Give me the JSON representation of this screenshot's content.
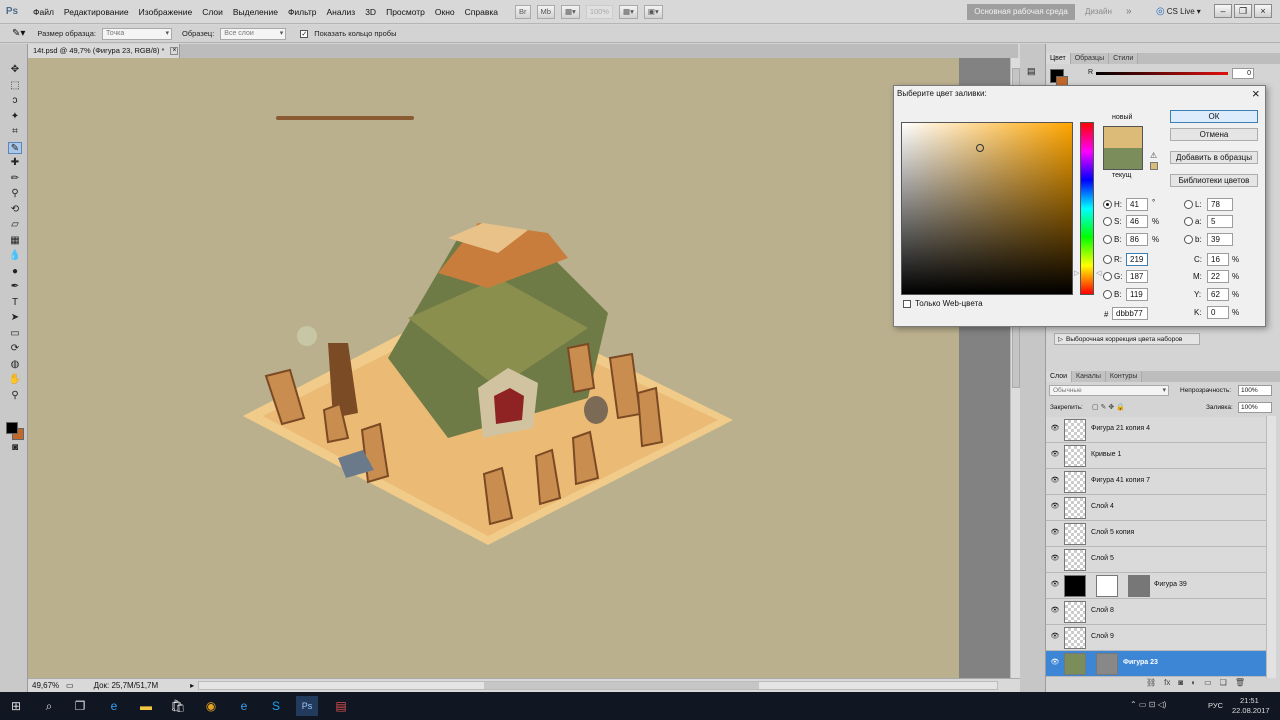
{
  "app": {
    "logo": "Ps"
  },
  "menu": [
    "Файл",
    "Редактирование",
    "Изображение",
    "Слои",
    "Выделение",
    "Фильтр",
    "Анализ",
    "3D",
    "Просмотр",
    "Окно",
    "Справка"
  ],
  "toolbar": {
    "zoom": "100%",
    "workspace": "Основная рабочая среда",
    "design": "Дизайн",
    "more": "»",
    "cslive": "CS Live"
  },
  "options_bar": {
    "sample_size_label": "Размер образца:",
    "sample_size_value": "Точка",
    "sample_label": "Образец:",
    "sample_value": "Все слои",
    "ring_label": "Показать кольцо пробы"
  },
  "document": {
    "tab_title": "14t.psd @ 49,7% (Фигура 23, RGB/8) *",
    "zoom_status": "49,67%",
    "doc_size": "Док: 25,7M/51,7M"
  },
  "color_panel": {
    "tabs": [
      "Цвет",
      "Образцы",
      "Стили"
    ],
    "r_label": "R",
    "r_value": "0"
  },
  "adjustments": {
    "item": "Выборочная коррекция цвета наборов"
  },
  "layers_panel": {
    "tabs": [
      "Слои",
      "Каналы",
      "Контуры"
    ],
    "blend_mode": "Обычные",
    "opacity_label": "Непрозрачность:",
    "opacity_value": "100%",
    "lock_label": "Закрепить:",
    "fill_label": "Заливка:",
    "fill_value": "100%",
    "layers": [
      {
        "name": "Фигура 21 копия 4"
      },
      {
        "name": "Кривые 1"
      },
      {
        "name": "Фигура 41 копия 7"
      },
      {
        "name": "Слой 4"
      },
      {
        "name": "Слой 5 копия"
      },
      {
        "name": "Слой 5"
      },
      {
        "name": "Фигура 39"
      },
      {
        "name": "Слой 8"
      },
      {
        "name": "Слой 9"
      },
      {
        "name": "Фигура 23"
      }
    ]
  },
  "dialog": {
    "title": "Выберите цвет заливки:",
    "close": "×",
    "ok": "ОК",
    "cancel": "Отмена",
    "add_swatches": "Добавить в образцы",
    "libraries": "Библиотеки цветов",
    "new_label": "новый",
    "current_label": "текущ",
    "new_color": "#dbbb77",
    "current_color": "#7b8d5a",
    "web_only": "Только Web-цвета",
    "h_label": "H:",
    "h_value": "41",
    "h_unit": "°",
    "s_label": "S:",
    "s_value": "46",
    "s_unit": "%",
    "b_label": "B:",
    "b_value": "86",
    "b_unit": "%",
    "r_label": "R:",
    "r_value": "219",
    "g_label": "G:",
    "g_value": "187",
    "b2_label": "B:",
    "b2_value": "119",
    "hex_label": "#",
    "hex_value": "dbbb77",
    "l_label": "L:",
    "l_value": "78",
    "a_label": "a:",
    "a_value": "5",
    "lab_b_label": "b:",
    "lab_b_value": "39",
    "c_label": "C:",
    "c_value": "16",
    "c_unit": "%",
    "m_label": "M:",
    "m_value": "22",
    "m_unit": "%",
    "y_label": "Y:",
    "y_value": "62",
    "y_unit": "%",
    "k_label": "K:",
    "k_value": "0",
    "k_unit": "%"
  },
  "taskbar": {
    "lang": "РУС",
    "time": "21:51",
    "date": "22.08.2017"
  }
}
